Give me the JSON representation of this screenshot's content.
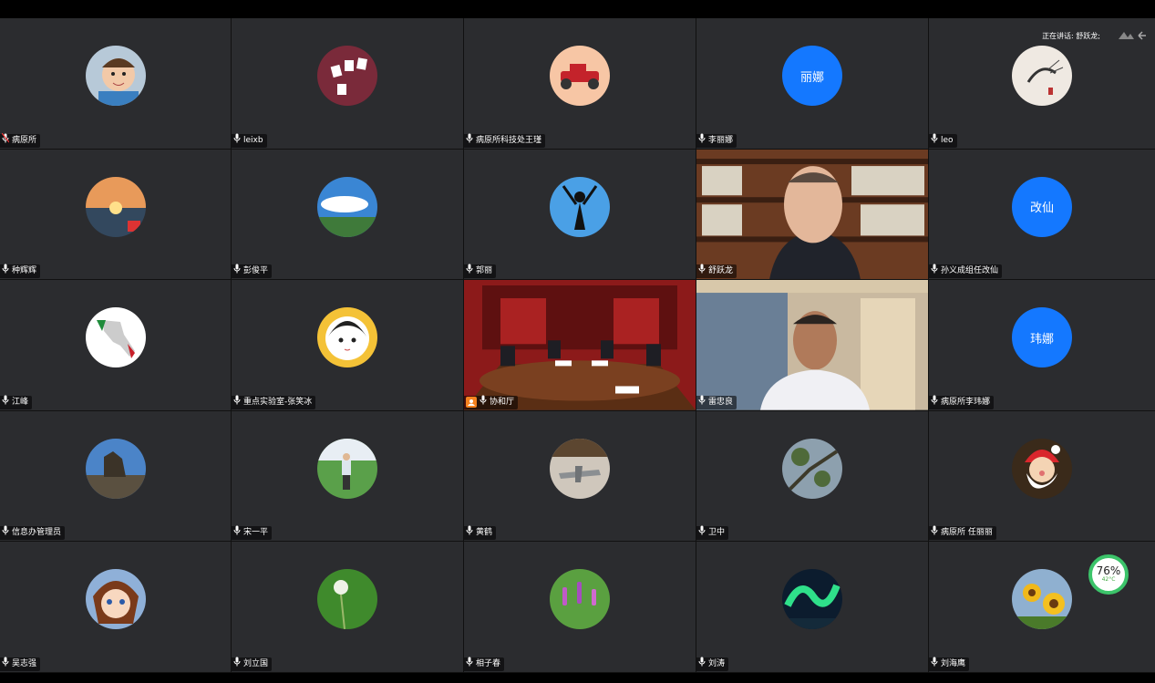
{
  "meeting": {
    "active_speaker_prefix": "正在讲话: 舒跃龙;",
    "tiles": [
      {
        "name": "病原所",
        "avatar": "child-photo",
        "mic": false
      },
      {
        "name": "leixb",
        "avatar": "cards-photo",
        "mic": true
      },
      {
        "name": "病原所科技处王瑾",
        "avatar": "red-car",
        "mic": true
      },
      {
        "name": "李丽娜",
        "avatar_text": "丽娜",
        "mic": true
      },
      {
        "name": "leo",
        "avatar": "shrimp-painting",
        "mic": true
      },
      {
        "name": "种辉辉",
        "avatar": "sunset",
        "mic": true
      },
      {
        "name": "彭俊平",
        "avatar": "sky-clouds",
        "mic": true
      },
      {
        "name": "郭丽",
        "avatar": "silhouette",
        "mic": true
      },
      {
        "name": "舒跃龙",
        "video": "man-bookshelf",
        "mic": true,
        "active": true
      },
      {
        "name": "孙义成组任改仙",
        "avatar_text": "改仙",
        "mic": true
      },
      {
        "name": "江峰",
        "avatar": "italy-map",
        "mic": true
      },
      {
        "name": "重点实验室-张笑冰",
        "avatar": "cartoon-girl",
        "mic": true
      },
      {
        "name": "协和厅",
        "video": "conference-room",
        "mic": true,
        "host": true
      },
      {
        "name": "雷忠良",
        "video": "man-room",
        "mic": true
      },
      {
        "name": "病原所李玮娜",
        "avatar_text": "玮娜",
        "mic": true
      },
      {
        "name": "信息办管理员",
        "avatar": "statue",
        "mic": true
      },
      {
        "name": "宋一平",
        "avatar": "man-garden",
        "mic": true
      },
      {
        "name": "黄鹤",
        "avatar": "plane-model",
        "mic": true
      },
      {
        "name": "卫中",
        "avatar": "tree-branch",
        "mic": true
      },
      {
        "name": "病原所 任丽丽",
        "avatar": "santa",
        "mic": true
      },
      {
        "name": "吴志强",
        "avatar": "anime-boy",
        "mic": true
      },
      {
        "name": "刘立国",
        "avatar": "dandelion",
        "mic": true
      },
      {
        "name": "相子春",
        "avatar": "lupine-flowers",
        "mic": true
      },
      {
        "name": "刘涛",
        "avatar": "aurora",
        "mic": true
      },
      {
        "name": "刘海鹰",
        "avatar": "sunflowers",
        "mic": true
      }
    ]
  },
  "perf_widget": {
    "percent": "76%",
    "temp": "42°C"
  },
  "colors": {
    "tile_bg": "#2b2c2f",
    "avatar_blue": "#1478ff",
    "active_border": "#3ddc6b",
    "widget_ring": "#3cc46a"
  }
}
